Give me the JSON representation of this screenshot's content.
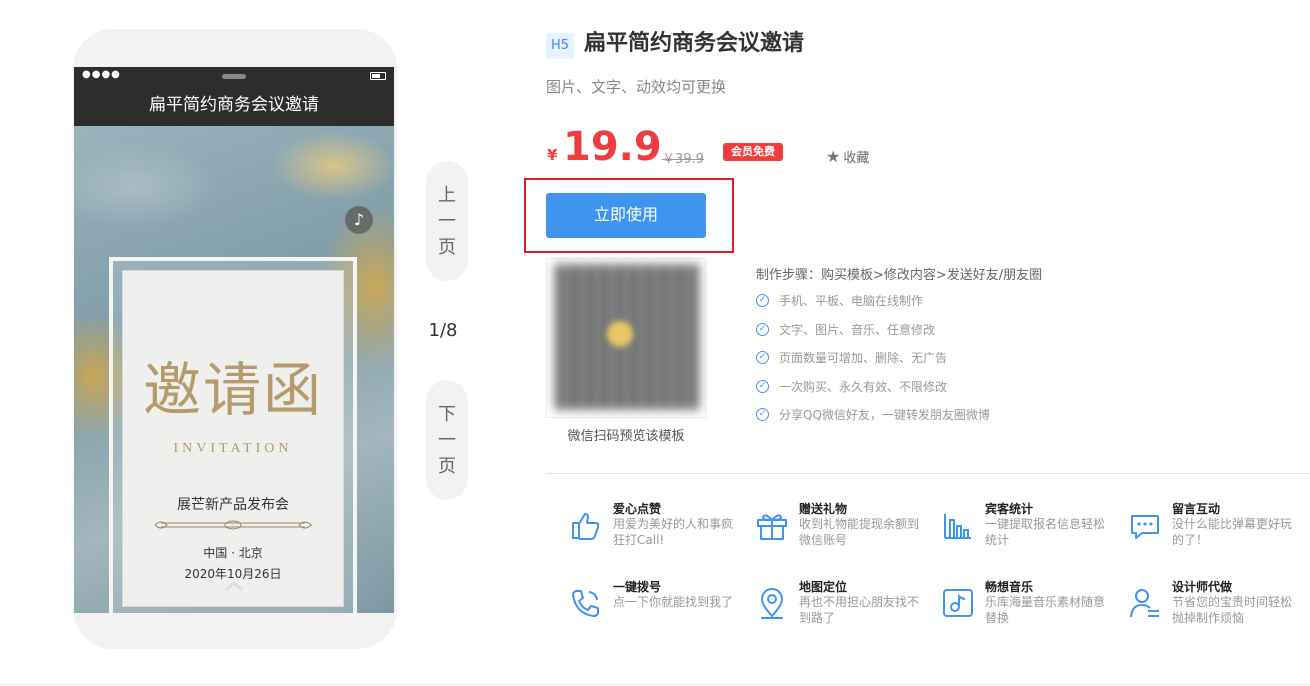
{
  "phone": {
    "title": "扁平简约商务会议邀请",
    "invite_heading": "邀请函",
    "invite_sub": "INVITATION",
    "event_name": "展芒新产品发布会",
    "event_location": "中国 · 北京",
    "event_date": "2020年10月26日",
    "music_icon": "music-note-icon"
  },
  "pager": {
    "prev_chars": [
      "上",
      "一",
      "页"
    ],
    "next_chars": [
      "下",
      "一",
      "页"
    ],
    "indicator": "1/8"
  },
  "product": {
    "badge": "H5",
    "title": "扁平简约商务会议邀请",
    "subtitle": "图片、文字、动效均可更换",
    "currency": "¥",
    "price": "19.9",
    "original_price": "￥39.9",
    "vip_label": "会员免费",
    "favorite_label": "收藏",
    "use_button": "立即使用",
    "qr_caption": "微信扫码预览该模板",
    "accent_color": "#3f94f0",
    "price_color": "#f03c3c"
  },
  "steps": {
    "title": "制作步骤：购买模板>修改内容>发送好友/朋友圈",
    "items": [
      "手机、平板、电脑在线制作",
      "文字、图片、音乐、任意修改",
      "页面数量可增加、删除、无广告",
      "一次购买、永久有效、不限修改",
      "分享QQ微信好友，一键转发朋友圈微博"
    ]
  },
  "features": [
    {
      "icon": "thumbs-up-icon",
      "title": "爱心点赞",
      "desc": "用爱为美好的人和事疯狂打Call!"
    },
    {
      "icon": "gift-icon",
      "title": "赠送礼物",
      "desc": "收到礼物能提现余额到微信账号"
    },
    {
      "icon": "bar-chart-icon",
      "title": "宾客统计",
      "desc": "一键提取报名信息轻松统计"
    },
    {
      "icon": "chat-bubble-icon",
      "title": "留言互动",
      "desc": "没什么能比弹幕更好玩的了！"
    },
    {
      "icon": "phone-call-icon",
      "title": "一键拨号",
      "desc": "点一下你就能找到我了"
    },
    {
      "icon": "map-pin-icon",
      "title": "地图定位",
      "desc": "再也不用担心朋友找不到路了"
    },
    {
      "icon": "music-note-icon",
      "title": "畅想音乐",
      "desc": "乐库海量音乐素材随意替换"
    },
    {
      "icon": "designer-icon",
      "title": "设计师代做",
      "desc": "节省您的宝贵时间轻松抛掉制作烦恼"
    }
  ]
}
